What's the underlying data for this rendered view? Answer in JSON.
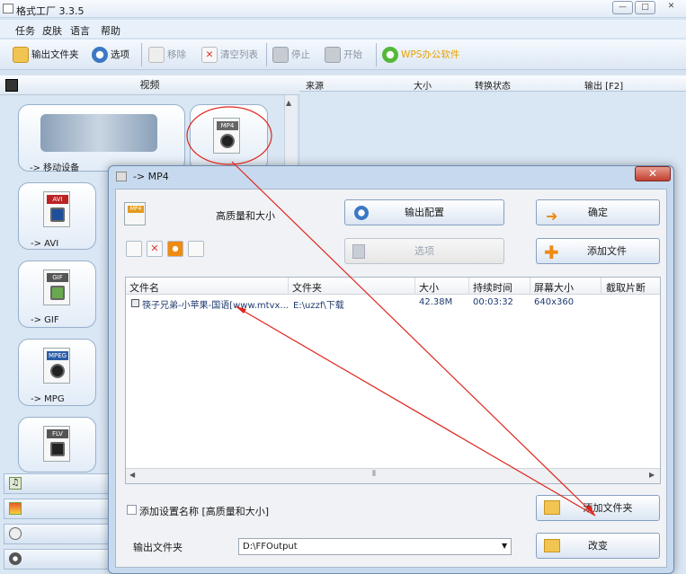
{
  "app": {
    "title": "格式工厂 3.3.5",
    "window_buttons": [
      "—",
      "□",
      "✕"
    ]
  },
  "menu": [
    "任务",
    "皮肤",
    "语言",
    "帮助"
  ],
  "toolbar": {
    "output_folder": "输出文件夹",
    "options": "选项",
    "remove": "移除",
    "clear_list": "清空列表",
    "stop": "停止",
    "start": "开始",
    "wps": "WPS办公软件"
  },
  "left_panel": {
    "header": "视频",
    "tiles": [
      {
        "label": "-> 移动设备",
        "icon": "mobile-devices-icon"
      },
      {
        "label": "-> MP4",
        "icon": "mp4-icon"
      },
      {
        "label": "-> AVI",
        "icon": "avi-icon"
      },
      {
        "label": "-> GIF",
        "icon": "gif-icon"
      },
      {
        "label": "-> MPG",
        "icon": "mpg-icon"
      },
      {
        "label": "",
        "icon": "flv-icon"
      }
    ]
  },
  "task_list": {
    "columns": [
      "来源",
      "大小",
      "转换状态",
      "输出 [F2]"
    ]
  },
  "dialog": {
    "title": "-> MP4",
    "preset": "高质量和大小",
    "output_config": "输出配置",
    "ok": "确定",
    "options": "选项",
    "add_file": "添加文件",
    "columns": [
      "文件名",
      "文件夹",
      "大小",
      "持续时间",
      "屏幕大小",
      "截取片断"
    ],
    "rows": [
      {
        "name": "筷子兄弟-小苹果-国语[www.mtvx...",
        "folder": "E:\\uzzf\\下载",
        "size": "42.38M",
        "duration": "00:03:32",
        "screen": "640x360",
        "clip": ""
      }
    ],
    "add_setting_name": "添加设置名称 [高质量和大小]",
    "add_folder": "添加文件夹",
    "output_folder_label": "输出文件夹",
    "output_folder_value": "D:\\FFOutput",
    "change": "改变"
  },
  "colors": {
    "accent": "#3b6eb5",
    "annotation": "#e0241b",
    "wps": "#e8a100"
  }
}
